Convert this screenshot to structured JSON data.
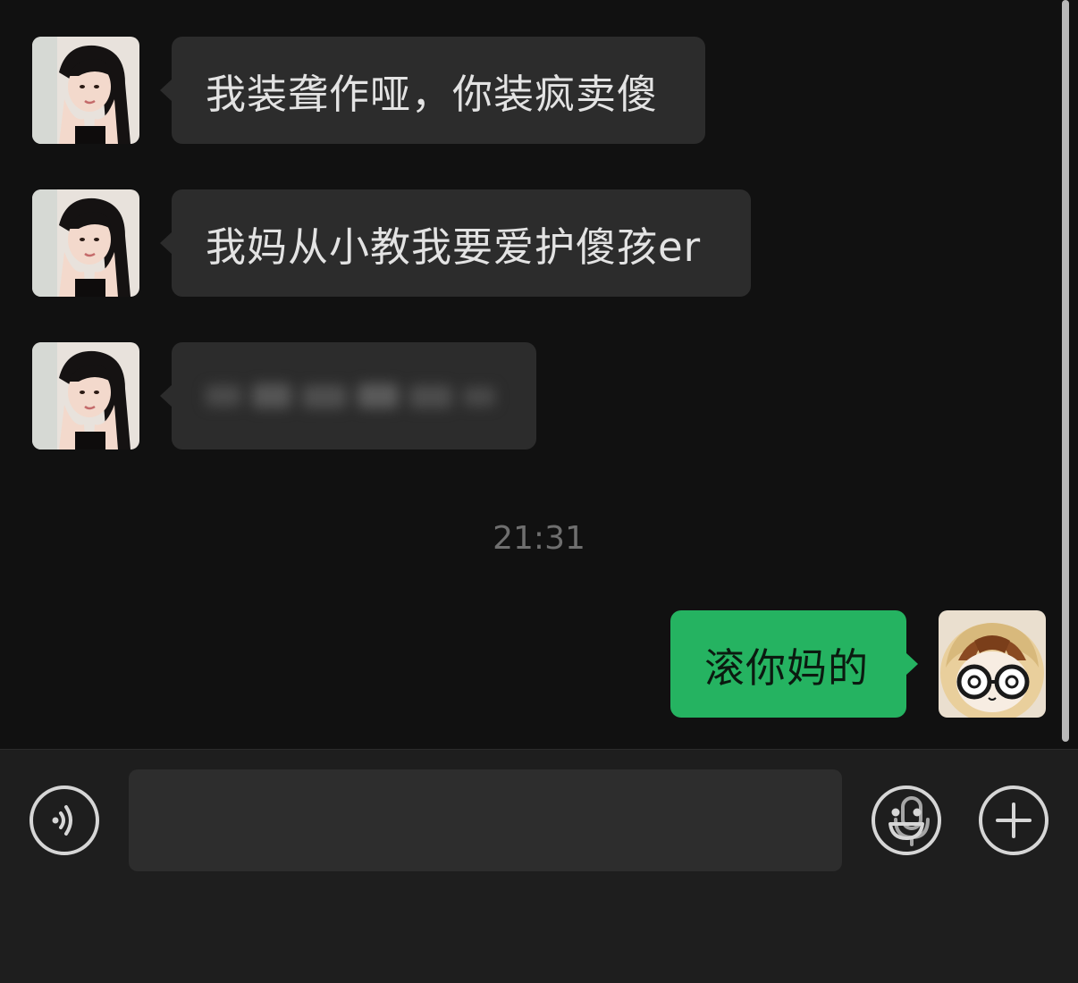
{
  "conversation": {
    "messages": [
      {
        "direction": "incoming",
        "sender_avatar": "girl-portrait-avatar",
        "text": "我装聋作哑，你装疯卖傻"
      },
      {
        "direction": "incoming",
        "sender_avatar": "girl-portrait-avatar",
        "text": "我妈从小教我要爱护傻孩er"
      },
      {
        "direction": "incoming",
        "sender_avatar": "girl-portrait-avatar",
        "text": "",
        "note_blurred": true
      },
      {
        "direction": "outgoing",
        "sender_avatar": "cartoon-glasses-avatar",
        "text": "滚你妈的"
      }
    ],
    "timestamp": "21:31"
  },
  "input_bar": {
    "voice_icon": "voice-mode-icon",
    "text_value": "",
    "mic_icon": "microphone-icon",
    "emoji_icon": "emoji-icon",
    "more_icon": "plus-icon"
  },
  "theme": {
    "background": "#111111",
    "incoming_bubble": "#2c2c2c",
    "outgoing_bubble": "#25b361",
    "input_bar": "#1e1e1e"
  }
}
